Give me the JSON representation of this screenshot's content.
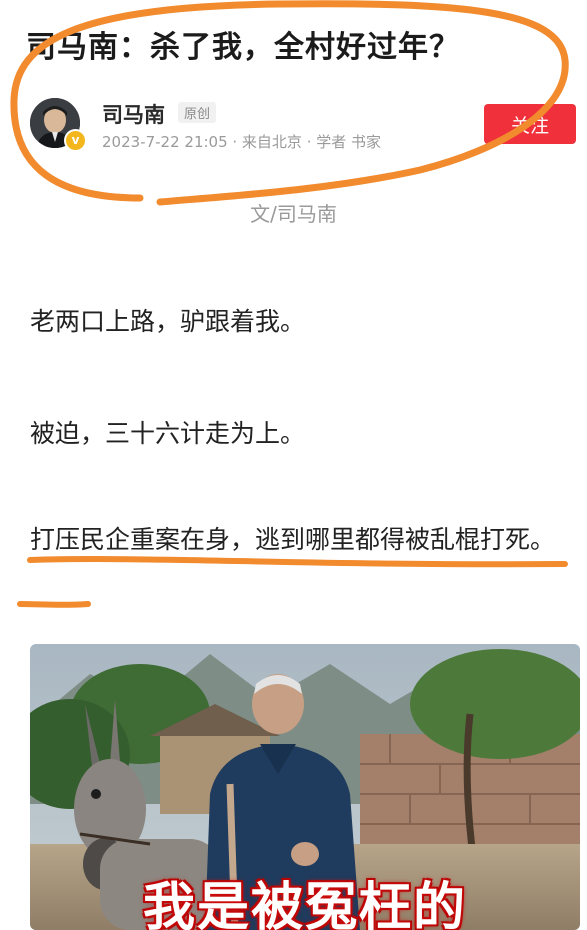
{
  "article": {
    "title": "司马南：杀了我，全村好过年？",
    "byline": "文/司马南",
    "paragraphs": [
      "老两口上路，驴跟着我。",
      "被迫，三十六计走为上。",
      "打压民企重案在身，逃到哪里都得被乱棍打死。"
    ]
  },
  "author": {
    "name": "司马南",
    "original_tag": "原创",
    "meta": "2023-7-22 21:05 · 来自北京 · 学者 书家",
    "verified_symbol": "v",
    "follow_label": "关注"
  },
  "image": {
    "caption": "我是被冤枉的"
  },
  "colors": {
    "follow_button": "#f0303a",
    "marker": "#f28a2e",
    "verified": "#f3b71d"
  },
  "icons": {
    "avatar": "avatar-photo",
    "verified": "verified-badge-icon"
  }
}
